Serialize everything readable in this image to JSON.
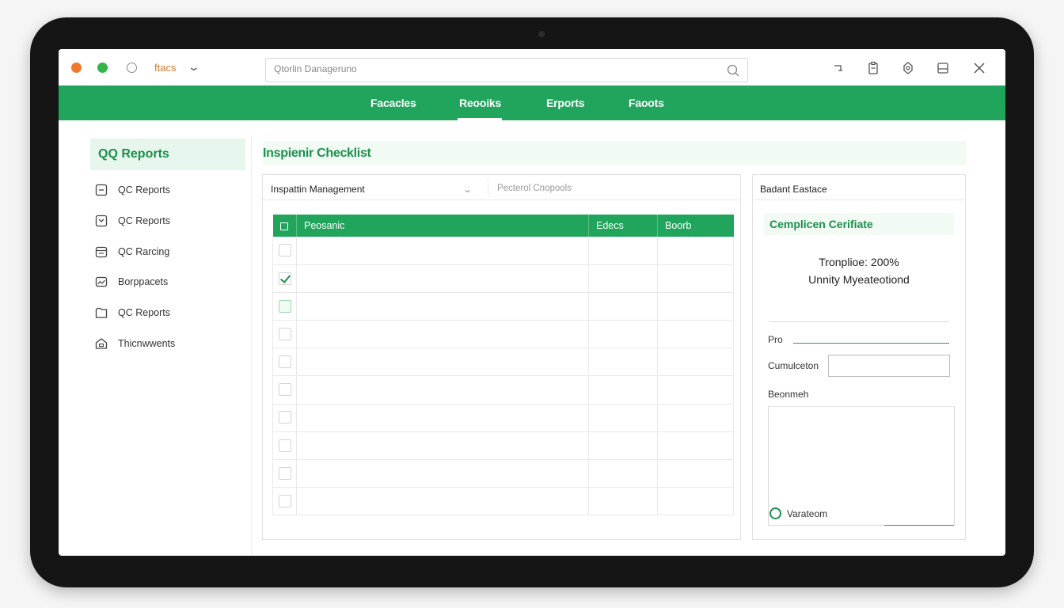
{
  "window": {
    "title": "ftacs",
    "search_placeholder": "Qtorlin Danageruno"
  },
  "nav": {
    "items": [
      "Facacles",
      "Reooiks",
      "Erports",
      "Faoots"
    ],
    "active_index": 1
  },
  "sidebar": {
    "heading": "QQ Reports",
    "items": [
      {
        "label": "QC Reports",
        "icon": "report-icon"
      },
      {
        "label": "QC Reports",
        "icon": "report-icon"
      },
      {
        "label": "QC Rarcing",
        "icon": "calendar-icon"
      },
      {
        "label": "Borppacets",
        "icon": "image-icon"
      },
      {
        "label": "QC Reports",
        "icon": "folder-icon"
      },
      {
        "label": "Thicnwwents",
        "icon": "home-icon"
      }
    ]
  },
  "main": {
    "heading": "Inspienir Checklist",
    "panel_label": "Inspattin Management",
    "select_value": "Pecterol Cnopools",
    "table": {
      "headers": [
        "Peosanic",
        "Edecs",
        "Boorb"
      ],
      "rows": [
        {
          "state": "empty"
        },
        {
          "state": "checked"
        },
        {
          "state": "highlighted"
        },
        {
          "state": "empty"
        },
        {
          "state": "empty"
        },
        {
          "state": "empty"
        },
        {
          "state": "empty"
        },
        {
          "state": "empty"
        },
        {
          "state": "empty"
        },
        {
          "state": "empty"
        }
      ]
    }
  },
  "right_panel": {
    "heading": "Badant Eastace",
    "cert_title": "Cemplicen Cerifiate",
    "cert_line1": "Tronplioe: 200%",
    "cert_line2": "Unnity Myeateotiond",
    "field_pro": "Pro",
    "field_completion": "Cumulceton",
    "field_notes": "Beonmeh",
    "radio_label": "Varateom"
  },
  "colors": {
    "accent": "#21a55c",
    "accent_text": "#1c8f4c",
    "dot_orange": "#ee7a2e",
    "dot_green": "#33b54a"
  }
}
